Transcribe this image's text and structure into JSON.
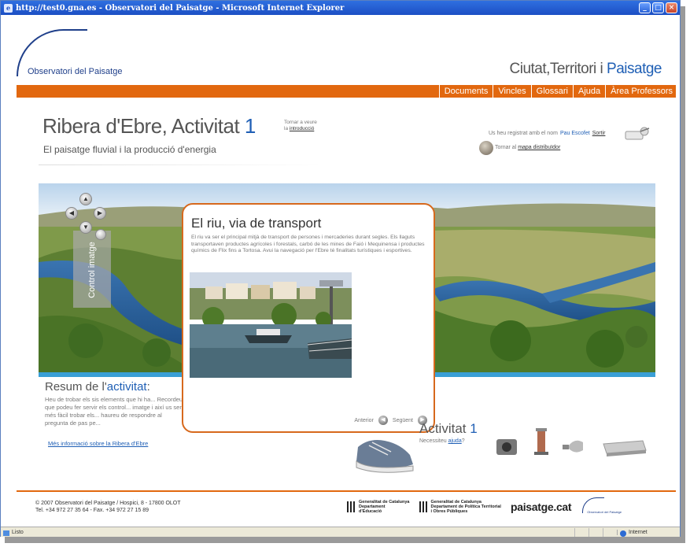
{
  "window": {
    "title": "http://test0.gna.es - Observatori del Paisatge - Microsoft Internet Explorer",
    "controls": {
      "minimize": "_",
      "maximize": "□",
      "close": "×"
    }
  },
  "header": {
    "logo_text": "Observatori del Paisatge",
    "site_title_part1": "Ciutat,Territori i ",
    "site_title_part2": "Paisatge"
  },
  "nav": {
    "items": [
      {
        "label": "Documents"
      },
      {
        "label": "Vincles"
      },
      {
        "label": "Glossari"
      },
      {
        "label": "Ajuda"
      },
      {
        "label": "Àrea Professors"
      }
    ]
  },
  "page": {
    "title": "Ribera d'Ebre, Activitat ",
    "title_num": "1",
    "subtitle": "El paisatge fluvial i la producció d'energia",
    "intro_line1": "Tornar a veure",
    "intro_line2_prefix": "la ",
    "intro_link": "introducció"
  },
  "user": {
    "registered_text": "Us heu registrat amb el nom",
    "name": "Pau Escofet",
    "logout": "Sortir",
    "map_prefix": "Tornar al ",
    "map_link": "mapa distribuïdor"
  },
  "image_control": {
    "label": "Control imatge",
    "up": "▲",
    "left": "◀",
    "right": "▶",
    "down": "▼"
  },
  "modal": {
    "title": "El riu, via de transport",
    "text": "El riu va ser el principal mitjà de transport de persones i mercaderies durant segles. Els llaguts transportaven productes agrícoles i forestals, carbó de les mines de Faió i Mequinensa i productes químics de Flix fins a Tortosa. Avui la navegació per l'Ebre té finalitats turístiques i esportives.",
    "prev": "Anterior",
    "next": "Següent",
    "prev_icon": "◀",
    "next_icon": "▶"
  },
  "summary": {
    "title_prefix": "Resum de l'",
    "title_hl": "activitat",
    "title_suffix": ":",
    "text": "Heu de trobar els sis elements que hi ha... Recordeu que podeu fer servir els control... imatge i així us serà més fàcil trobar els... haureu de respondre al pregunta de pas pe...",
    "more_link": "Més informació sobre la Ribera d'Ebre"
  },
  "activity": {
    "title": "Activitat ",
    "num": "1",
    "help_prefix": "Necessiteu ",
    "help_link": "ajuda",
    "help_suffix": "?"
  },
  "footer": {
    "line1": "© 2007 Observatori del Paisatge / Hospici, 8 - 17800 OLOT",
    "line2": "Tel. +34 972 27 35 64 - Fax. +34 972 27 15 89",
    "logo1_line1": "Generalitat de Catalunya",
    "logo1_line2": "Departament",
    "logo1_line3": "d'Educació",
    "logo2_line1": "Generalitat de Catalunya",
    "logo2_line2": "Departament de Política Territorial",
    "logo2_line3": "i Obres Públiques",
    "paisatge_cat": "paisatge.cat",
    "small_logo_text": "Observatori del Paisatge"
  },
  "status": {
    "left": "Listo",
    "right": "Internet"
  },
  "colors": {
    "accent": "#e2680f",
    "brand_blue": "#1f5fb5"
  }
}
